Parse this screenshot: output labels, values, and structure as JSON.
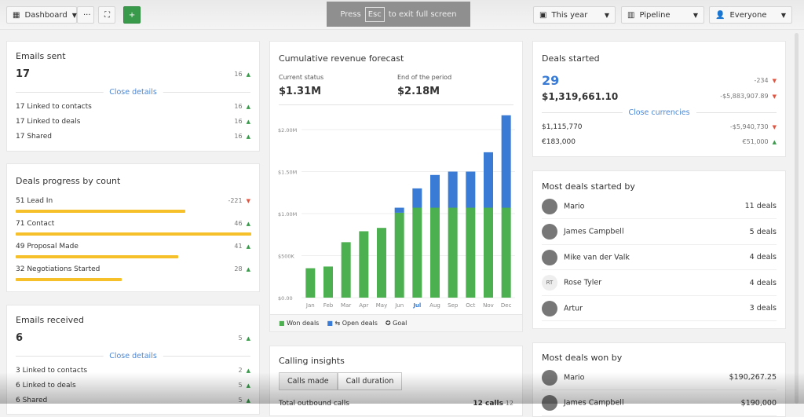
{
  "toolbar": {
    "dashboard": "Dashboard",
    "more": "···",
    "fullscreen": "⛶",
    "add": "+",
    "period": "This year",
    "pipeline": "Pipeline",
    "user": "Everyone"
  },
  "toast": {
    "press": "Press",
    "key": "Esc",
    "rest": "to exit full screen"
  },
  "emails_sent": {
    "title": "Emails sent",
    "value": "17",
    "delta": "16",
    "toggle": "Close details",
    "rows": [
      {
        "label": "17 Linked to contacts",
        "delta": "16"
      },
      {
        "label": "17 Linked to deals",
        "delta": "16"
      },
      {
        "label": "17 Shared",
        "delta": "16"
      }
    ]
  },
  "deals_progress": {
    "title": "Deals progress by count",
    "rows": [
      {
        "label": "51 Lead In",
        "delta": "-221",
        "dir": "down",
        "pct": 72
      },
      {
        "label": "71 Contact",
        "delta": "46",
        "dir": "up",
        "pct": 100
      },
      {
        "label": "49 Proposal Made",
        "delta": "41",
        "dir": "up",
        "pct": 69
      },
      {
        "label": "32 Negotiations Started",
        "delta": "28",
        "dir": "up",
        "pct": 45
      }
    ],
    "bar_color": "#f5c02a"
  },
  "emails_received": {
    "title": "Emails received",
    "value": "6",
    "delta": "5",
    "toggle": "Close details",
    "rows": [
      {
        "label": "3 Linked to contacts",
        "delta": "2"
      },
      {
        "label": "6 Linked to deals",
        "delta": "5"
      },
      {
        "label": "6 Shared",
        "delta": "5"
      }
    ]
  },
  "forecast": {
    "title": "Cumulative revenue forecast",
    "current_label": "Current status",
    "current_value": "$1.31M",
    "end_label": "End of the period",
    "end_value": "$2.18M",
    "legend": {
      "won": "Won deals",
      "open": "Open deals",
      "goal": "Goal"
    }
  },
  "chart_data": {
    "type": "bar",
    "stacked": true,
    "categories": [
      "Jan",
      "Feb",
      "Mar",
      "Apr",
      "May",
      "Jun",
      "Jul",
      "Aug",
      "Sep",
      "Oct",
      "Nov",
      "Dec"
    ],
    "highlight": "Jul",
    "series": [
      {
        "name": "Won deals",
        "color": "#4caf50",
        "values": [
          0.35,
          0.37,
          0.66,
          0.79,
          0.83,
          1.01,
          1.07,
          1.07,
          1.07,
          1.07,
          1.07,
          1.07
        ]
      },
      {
        "name": "Open deals",
        "color": "#3a7bd5",
        "values": [
          0,
          0,
          0,
          0,
          0,
          0.06,
          0.23,
          0.39,
          0.43,
          0.43,
          0.66,
          1.1
        ]
      }
    ],
    "yticks": [
      "$0.00",
      "$500K",
      "$1.00M",
      "$1.50M",
      "$2.00M"
    ],
    "ylim": [
      0,
      2.0
    ],
    "unit": "$M",
    "grid": true,
    "legend": "bottom-left"
  },
  "calling": {
    "title": "Calling insights",
    "tabs": [
      "Calls made",
      "Call duration"
    ],
    "row_label": "Total outbound calls",
    "row_value": "12 calls",
    "row_delta": "12"
  },
  "deals_started": {
    "title": "Deals started",
    "count": "29",
    "count_delta": "-234",
    "amount": "$1,319,661.10",
    "amount_delta": "-$5,883,907.89",
    "toggle": "Close currencies",
    "rows": [
      {
        "label": "$1,115,770",
        "delta": "-$5,940,730",
        "dir": "down"
      },
      {
        "label": "€183,000",
        "delta": "€51,000",
        "dir": "up"
      }
    ]
  },
  "most_started": {
    "title": "Most deals started by",
    "people": [
      {
        "name": "Mario",
        "value": "11 deals"
      },
      {
        "name": "James Campbell",
        "value": "5 deals"
      },
      {
        "name": "Mike van der Valk",
        "value": "4 deals"
      },
      {
        "name": "Rose Tyler",
        "value": "4 deals",
        "initials": "RT"
      },
      {
        "name": "Artur",
        "value": "3 deals"
      }
    ]
  },
  "most_won": {
    "title": "Most deals won by",
    "people": [
      {
        "name": "Mario",
        "value": "$190,267.25"
      },
      {
        "name": "James Campbell",
        "value": "$190,000"
      }
    ]
  }
}
